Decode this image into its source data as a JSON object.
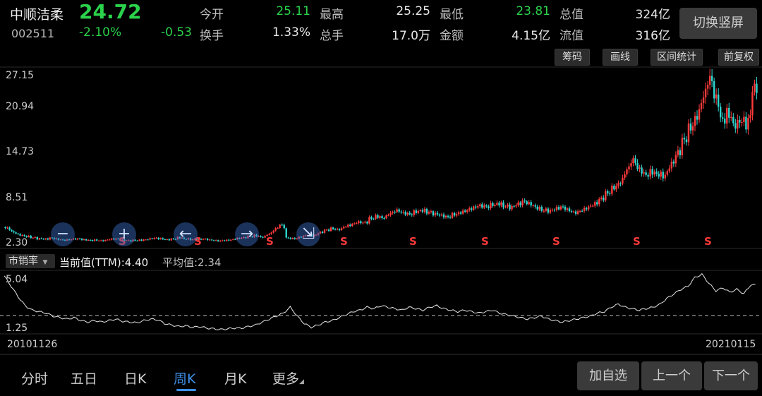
{
  "stock": {
    "name": "中顺洁柔",
    "code": "002511",
    "price": "24.72",
    "pct": "-2.10%",
    "change": "-0.53"
  },
  "quote": [
    {
      "label": "今开",
      "value": "25.11",
      "color": "green"
    },
    {
      "label": "最高",
      "value": "25.25",
      "color": "white"
    },
    {
      "label": "最低",
      "value": "23.81",
      "color": "green"
    },
    {
      "label": "总值",
      "value": "324亿",
      "color": "white"
    },
    {
      "label": "换手",
      "value": "1.33%",
      "color": "white"
    },
    {
      "label": "总手",
      "value": "17.0万",
      "color": "white"
    },
    {
      "label": "金额",
      "value": "4.15亿",
      "color": "white"
    },
    {
      "label": "流值",
      "value": "316亿",
      "color": "white"
    }
  ],
  "switch_label": "切换竖屏",
  "chart_buttons": [
    "筹码",
    "画线",
    "区间统计",
    "前复权"
  ],
  "price_axis": [
    "27.15",
    "20.94",
    "14.73",
    "8.51",
    "2.30"
  ],
  "controls": [
    "−",
    "+",
    "←",
    "→",
    "⇲"
  ],
  "s_mark": "S",
  "indicator": {
    "name": "市销率",
    "current": "当前值(TTM):4.40",
    "average": "平均值:2.34",
    "axis_top": "5.04",
    "axis_bottom": "1.25"
  },
  "dates": {
    "start": "20101126",
    "end": "20210115"
  },
  "tabs": [
    "分时",
    "五日",
    "日K",
    "周K",
    "月K",
    "更多"
  ],
  "active_tab": 3,
  "bottom_buttons": [
    "加自选",
    "上一个",
    "下一个"
  ],
  "colors": {
    "up": "#ff3b3b",
    "down": "#2fd6d0",
    "green": "#2bd24b",
    "active": "#3d8fe8"
  },
  "chart_data": {
    "type": "candlestick",
    "ylim": [
      2.3,
      27.15
    ],
    "x_start": "20101126",
    "x_end": "20210115",
    "closes": [
      4.6,
      4.0,
      3.6,
      3.4,
      3.2,
      3.0,
      2.9,
      3.1,
      2.95,
      2.8,
      2.9,
      3.0,
      2.85,
      2.75,
      2.8,
      2.7,
      2.9,
      3.0,
      2.8,
      2.7,
      2.75,
      2.8,
      2.9,
      3.1,
      3.0,
      2.85,
      2.9,
      3.2,
      3.0,
      2.9,
      2.85,
      2.95,
      2.8,
      2.7,
      2.75,
      2.8,
      3.0,
      3.1,
      3.3,
      3.5,
      3.2,
      3.6,
      4.2,
      5.3,
      3.1,
      3.0,
      3.2,
      3.6,
      3.4,
      3.8,
      4.2,
      4.5,
      4.3,
      4.8,
      5.0,
      5.4,
      5.2,
      5.9,
      6.3,
      6.0,
      6.6,
      7.1,
      6.8,
      6.5,
      6.9,
      7.2,
      6.9,
      6.6,
      6.4,
      6.1,
      6.5,
      6.8,
      7.1,
      7.4,
      7.8,
      7.6,
      7.9,
      8.2,
      7.8,
      7.5,
      7.9,
      8.4,
      8.1,
      7.6,
      7.2,
      7.0,
      7.3,
      7.6,
      7.2,
      6.8,
      7.1,
      7.5,
      7.9,
      8.6,
      9.5,
      10.4,
      11.0,
      12.6,
      14.5,
      13.2,
      12.2,
      12.8,
      12.5,
      12.0,
      13.5,
      15.0,
      17.0,
      19.0,
      20.5,
      23.0,
      26.5,
      24.0,
      20.0,
      21.5,
      19.5,
      20.5,
      19.0,
      24.7
    ]
  },
  "indicator_data": {
    "type": "line",
    "ylim": [
      1.25,
      5.04
    ],
    "average": 2.34,
    "values": [
      5.0,
      4.3,
      3.6,
      3.0,
      2.7,
      2.6,
      2.5,
      2.3,
      2.2,
      2.1,
      2.2,
      2.0,
      1.9,
      2.0,
      1.9,
      2.0,
      2.1,
      1.95,
      1.9,
      1.85,
      2.0,
      2.1,
      2.05,
      1.8,
      1.7,
      1.6,
      1.65,
      1.55,
      1.6,
      1.5,
      1.45,
      1.4,
      1.45,
      1.5,
      1.5,
      1.6,
      1.7,
      1.9,
      2.1,
      2.3,
      2.5,
      2.9,
      2.3,
      1.8,
      1.55,
      1.7,
      1.9,
      2.0,
      2.2,
      2.4,
      2.6,
      2.7,
      2.9,
      2.8,
      3.0,
      2.9,
      2.8,
      2.7,
      2.9,
      2.8,
      2.7,
      2.9,
      3.0,
      2.8,
      2.7,
      2.6,
      2.7,
      2.6,
      2.5,
      2.6,
      2.7,
      2.5,
      2.4,
      2.3,
      2.2,
      2.1,
      2.2,
      2.3,
      2.1,
      2.0,
      1.9,
      2.0,
      2.1,
      2.2,
      2.3,
      2.5,
      2.6,
      2.9,
      3.1,
      2.9,
      2.8,
      2.7,
      2.8,
      2.9,
      3.1,
      3.5,
      3.8,
      4.1,
      4.3,
      4.9,
      5.1,
      4.5,
      4.0,
      4.2,
      3.9,
      4.1,
      3.8,
      4.4
    ]
  }
}
